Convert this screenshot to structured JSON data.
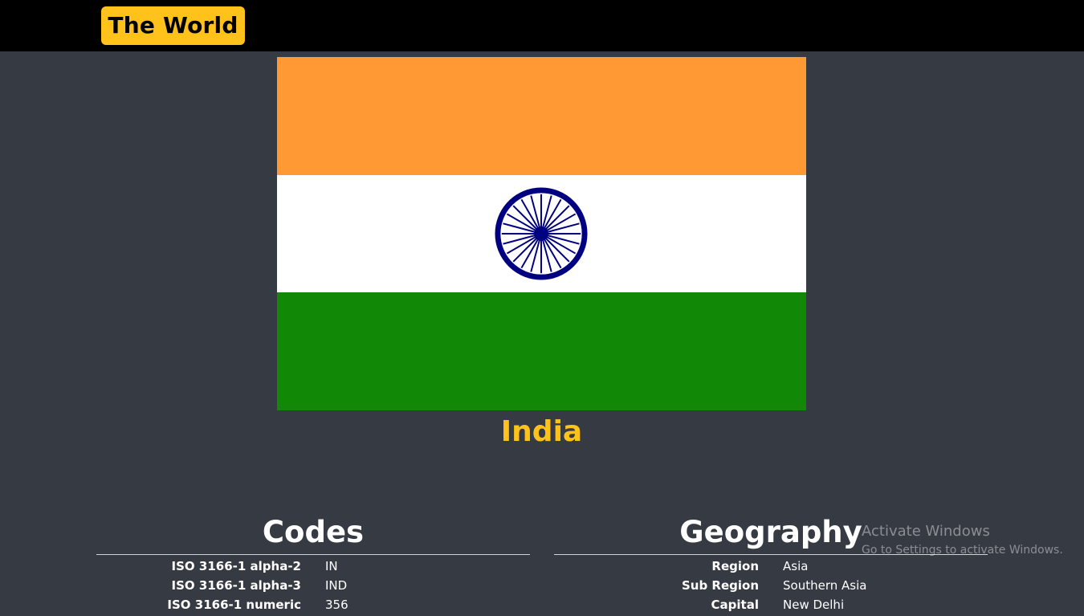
{
  "header": {
    "brand": "The World"
  },
  "country": {
    "name": "India",
    "flag_colors": {
      "top": "#ff9933",
      "middle": "#ffffff",
      "bottom": "#128807",
      "chakra": "#000080"
    }
  },
  "codes": {
    "title": "Codes",
    "rows": [
      {
        "key": "ISO 3166-1 alpha-2",
        "value": "IN"
      },
      {
        "key": "ISO 3166-1 alpha-3",
        "value": "IND"
      },
      {
        "key": "ISO 3166-1 numeric",
        "value": "356"
      }
    ]
  },
  "geography": {
    "title": "Geography",
    "rows": [
      {
        "key": "Region",
        "value": "Asia"
      },
      {
        "key": "Sub Region",
        "value": "Southern Asia"
      },
      {
        "key": "Capital",
        "value": "New Delhi"
      }
    ]
  },
  "watermark": {
    "line1": "Activate Windows",
    "line2": "Go to Settings to activate Windows."
  },
  "theme": {
    "background": "#363a42",
    "accent": "#ffc21a",
    "topbar": "#000000"
  }
}
